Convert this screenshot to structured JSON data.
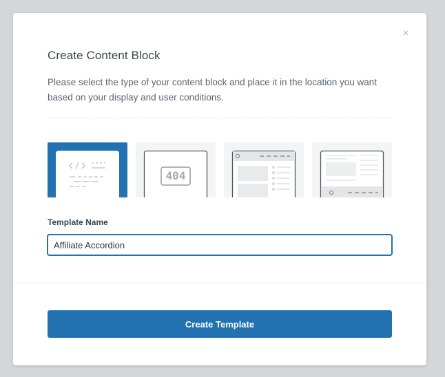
{
  "modal": {
    "close_icon": "close-icon",
    "close_glyph": "×",
    "title": "Create Content Block",
    "description": "Please select the type of your content block and place it in the location you want based on your display and user conditions.",
    "types": [
      {
        "icon": "custom-code-icon",
        "selected": true
      },
      {
        "icon": "error-404-icon",
        "label": "404",
        "selected": false
      },
      {
        "icon": "header-layout-icon",
        "selected": false
      },
      {
        "icon": "footer-layout-icon",
        "selected": false
      }
    ],
    "template_name_label": "Template Name",
    "template_name_value": "Affiliate Accordion",
    "create_button_label": "Create Template"
  },
  "colors": {
    "accent": "#2271b1",
    "card_bg": "#f3f4f6",
    "text_dark": "#3a4550",
    "text_muted": "#5a6570"
  }
}
